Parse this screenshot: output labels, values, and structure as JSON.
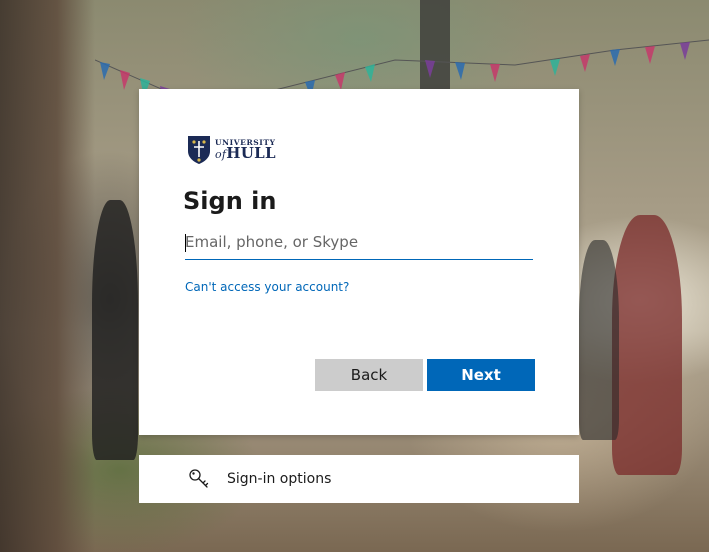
{
  "logo": {
    "line1": "UNIVERSITY",
    "line2_prefix": "of",
    "line2": "HULL"
  },
  "signin": {
    "title": "Sign in",
    "input_placeholder": "Email, phone, or Skype",
    "input_value": "",
    "cant_access_link": "Can't access your account?",
    "back_label": "Back",
    "next_label": "Next"
  },
  "options": {
    "label": "Sign-in options",
    "icon": "key-icon"
  },
  "colors": {
    "accent": "#0067b8",
    "back_button": "#cccccc",
    "card": "#ffffff",
    "logo_navy": "#1b2a55"
  }
}
